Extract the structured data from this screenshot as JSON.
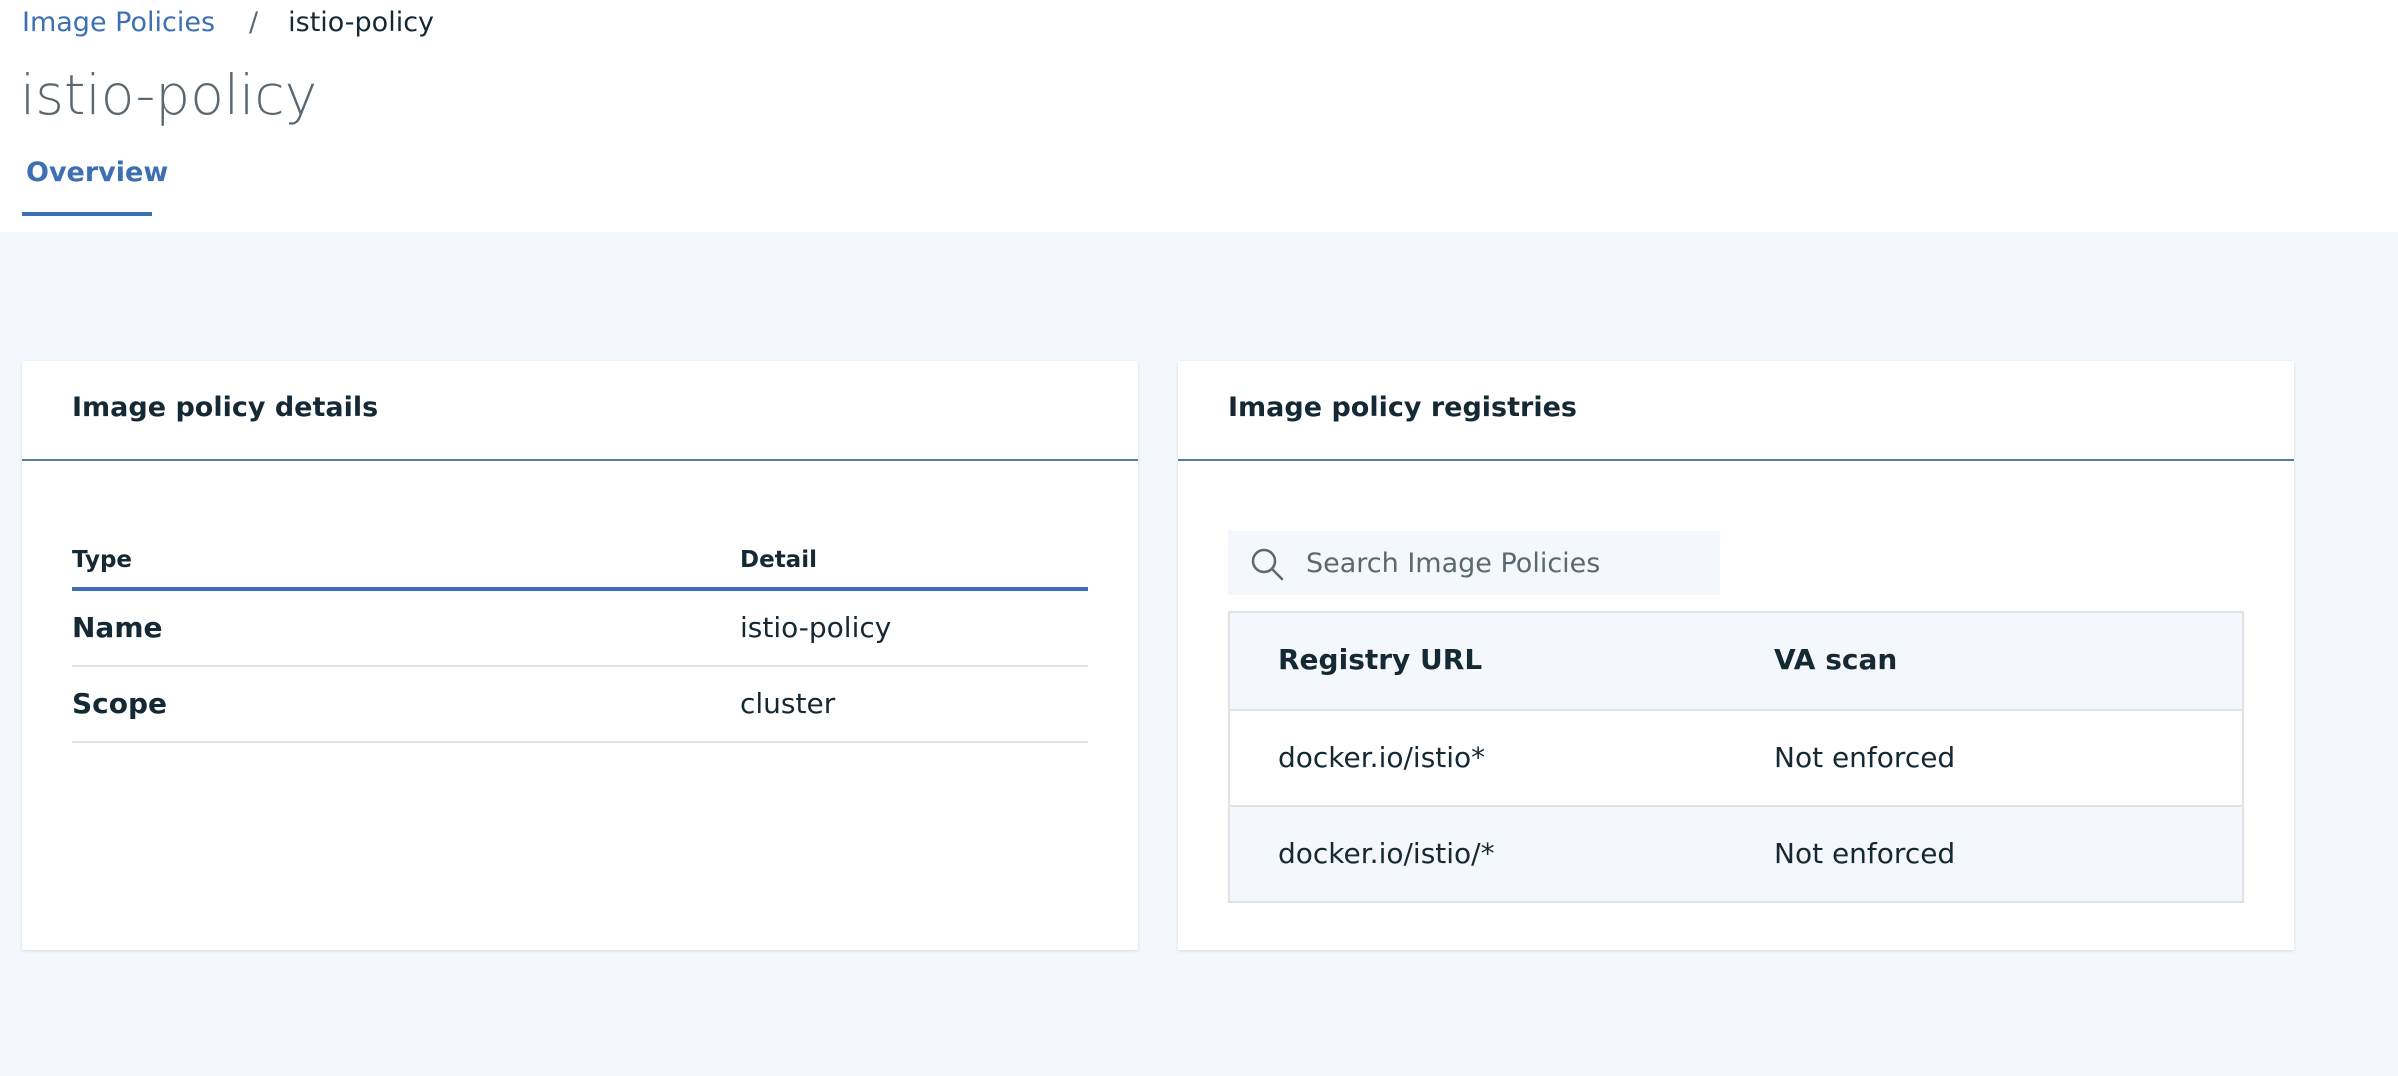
{
  "breadcrumb": {
    "parent": "Image Policies",
    "separator": "/",
    "current": "istio-policy"
  },
  "page": {
    "title": "istio-policy"
  },
  "tabs": [
    {
      "label": "Overview",
      "selected": true
    }
  ],
  "details_card": {
    "title": "Image policy details",
    "headers": {
      "type": "Type",
      "detail": "Detail"
    },
    "rows": [
      {
        "type": "Name",
        "detail": "istio-policy"
      },
      {
        "type": "Scope",
        "detail": "cluster"
      }
    ]
  },
  "registries_card": {
    "title": "Image policy registries",
    "search": {
      "placeholder": "Search Image Policies",
      "value": ""
    },
    "headers": {
      "url": "Registry URL",
      "va": "VA scan"
    },
    "rows": [
      {
        "url": "docker.io/istio*",
        "va": "Not enforced"
      },
      {
        "url": "docker.io/istio/*",
        "va": "Not enforced"
      }
    ]
  },
  "colors": {
    "accent": "#3d70b2",
    "text": "#152935",
    "background": "#f4f7fb"
  },
  "icons": {
    "search": "search-icon"
  }
}
